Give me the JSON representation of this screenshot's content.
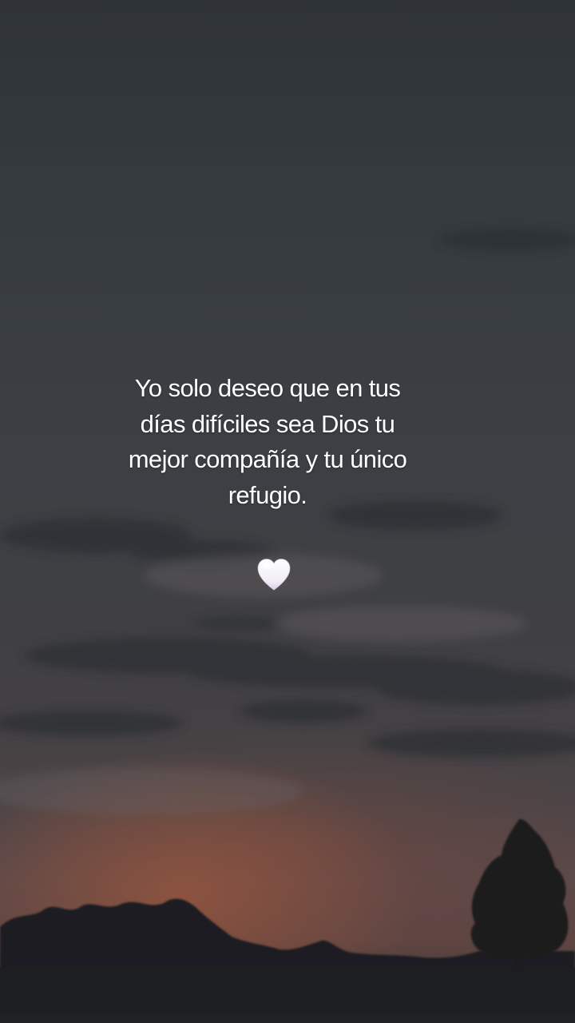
{
  "caption": {
    "lines": [
      "Yo solo deseo que en tus",
      "días difíciles sea Dios tu",
      "mejor compañía y tu único",
      "refugio."
    ]
  },
  "emoji": {
    "icon": "white-heart-icon",
    "glyph": "🤍"
  },
  "colors": {
    "sky_top": "#2f3337",
    "sky_mid": "#3f4044",
    "sunset_glow": "#b05c3a",
    "text": "#ffffff"
  }
}
